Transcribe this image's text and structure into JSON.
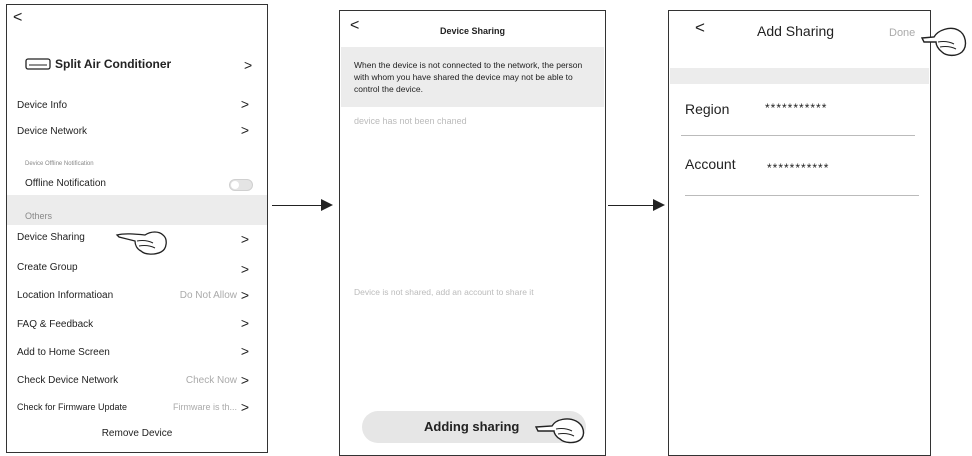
{
  "screen1": {
    "back": "<",
    "device_title": "Split Air Conditioner",
    "device_chevron": ">",
    "rows": [
      {
        "label": "Device Info",
        "value": "",
        "chevron": ">"
      },
      {
        "label": "Device Network",
        "value": "",
        "chevron": ">"
      }
    ],
    "offline_section_label": "Device Offline  Notification",
    "offline_label": "Offline  Notification",
    "others_label": "Others",
    "other_rows": [
      {
        "label": "Device Sharing",
        "value": "",
        "chevron": ">"
      },
      {
        "label": "Create Group",
        "value": "",
        "chevron": ">"
      },
      {
        "label": "Location Informatioan",
        "value": "Do Not Allow",
        "chevron": ">"
      },
      {
        "label": "FAQ & Feedback",
        "value": "",
        "chevron": ">"
      },
      {
        "label": "Add to Home Screen",
        "value": "",
        "chevron": ">"
      },
      {
        "label": "Check Device Network",
        "value": "Check Now",
        "chevron": ">"
      },
      {
        "label": "Check for Firmware Update",
        "value": "Firmware is th...",
        "chevron": ">"
      }
    ],
    "remove_label": "Remove Device"
  },
  "screen2": {
    "back": "<",
    "title": "Device Sharing",
    "notice": "When the device is not connected to the network, the person with whom you have shared the device may not be able to control the device.",
    "status": "device has not been chaned",
    "empty_msg": "Device is not shared, add an account to share it",
    "button_label": "Adding sharing"
  },
  "screen3": {
    "back": "<",
    "title": "Add Sharing",
    "done": "Done",
    "region_label": "Region",
    "region_value": "***********",
    "account_label": "Account",
    "account_value": "***********"
  },
  "colors": {
    "border": "#333333",
    "band": "#ececec",
    "muted": "#aaaaaa"
  },
  "icons": [
    "ac-unit-icon",
    "chevron-right-icon",
    "back-arrow-icon",
    "pointing-hand-icon",
    "toggle-switch",
    "flow-arrow-icon"
  ]
}
